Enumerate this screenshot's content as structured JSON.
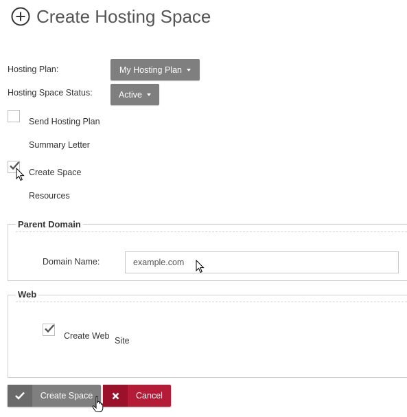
{
  "header": {
    "title": "Create Hosting Space",
    "icon": "plus-circle-icon"
  },
  "form": {
    "hosting_plan_label": "Hosting Plan:",
    "hosting_plan_value": "My Hosting Plan",
    "status_label": "Hosting Space Status:",
    "status_value": "Active",
    "send_letter_line1": "Send Hosting Plan",
    "send_letter_line2": "Summary Letter",
    "send_letter_checked": false,
    "create_resources_line1": "Create Space",
    "create_resources_line2": "Resources",
    "create_resources_checked": true
  },
  "parent_domain": {
    "legend": "Parent Domain",
    "domain_label": "Domain Name:",
    "domain_value": "example.com"
  },
  "web": {
    "legend": "Web",
    "create_web_site_part1": "Create Web",
    "create_web_site_part2": "Site",
    "create_web_site_checked": true
  },
  "actions": {
    "create_label": "Create Space",
    "cancel_label": "Cancel"
  },
  "colors": {
    "dropdown_bg": "#7f7f7f",
    "create_button_bg": "#7f7f7f",
    "create_button_icon_bg": "#6a6a6a",
    "cancel_button_bg": "#b31b36",
    "cancel_button_icon_bg": "#9b1129"
  }
}
